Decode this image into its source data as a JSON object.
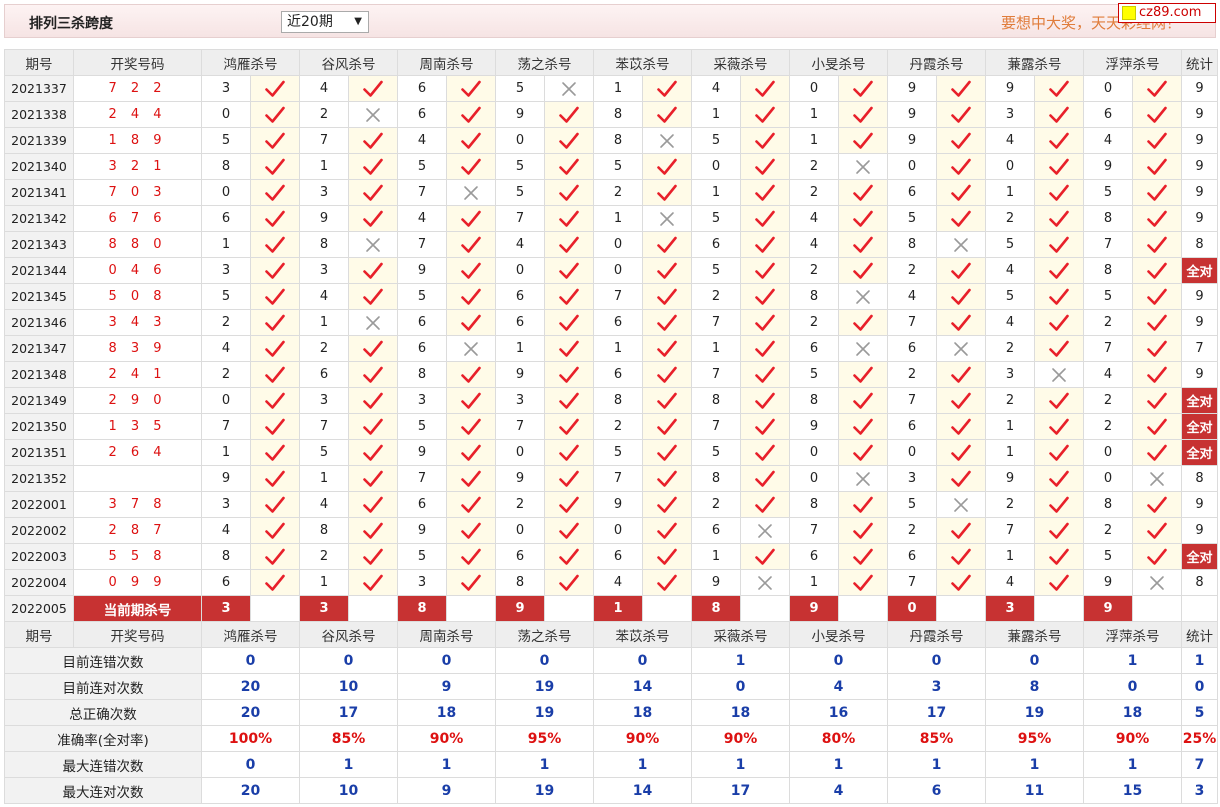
{
  "header": {
    "title": "排列三杀跨度",
    "period_select": "近20期",
    "slogan": "要想中大奖，天天彩经网！",
    "site_badge": "cz89.com"
  },
  "columns": {
    "period": "期号",
    "winning": "开奖号码",
    "experts": [
      "鸿雁杀号",
      "谷风杀号",
      "周南杀号",
      "荡之杀号",
      "苯苡杀号",
      "采薇杀号",
      "小旻杀号",
      "丹霞杀号",
      "蒹露杀号",
      "浮萍杀号"
    ],
    "stat": "统计"
  },
  "rows": [
    {
      "period": "2021337",
      "win": "7 2 2",
      "cells": [
        [
          3,
          1
        ],
        [
          4,
          1
        ],
        [
          6,
          1
        ],
        [
          5,
          0
        ],
        [
          1,
          1
        ],
        [
          4,
          1
        ],
        [
          0,
          1
        ],
        [
          9,
          1
        ],
        [
          9,
          1
        ],
        [
          0,
          1
        ]
      ],
      "stat": "9"
    },
    {
      "period": "2021338",
      "win": "2 4 4",
      "cells": [
        [
          0,
          1
        ],
        [
          2,
          0
        ],
        [
          6,
          1
        ],
        [
          9,
          1
        ],
        [
          8,
          1
        ],
        [
          1,
          1
        ],
        [
          1,
          1
        ],
        [
          9,
          1
        ],
        [
          3,
          1
        ],
        [
          6,
          1
        ]
      ],
      "stat": "9"
    },
    {
      "period": "2021339",
      "win": "1 8 9",
      "cells": [
        [
          5,
          1
        ],
        [
          7,
          1
        ],
        [
          4,
          1
        ],
        [
          0,
          1
        ],
        [
          8,
          0
        ],
        [
          5,
          1
        ],
        [
          1,
          1
        ],
        [
          9,
          1
        ],
        [
          4,
          1
        ],
        [
          4,
          1
        ]
      ],
      "stat": "9"
    },
    {
      "period": "2021340",
      "win": "3 2 1",
      "cells": [
        [
          8,
          1
        ],
        [
          1,
          1
        ],
        [
          5,
          1
        ],
        [
          5,
          1
        ],
        [
          5,
          1
        ],
        [
          0,
          1
        ],
        [
          2,
          0
        ],
        [
          0,
          1
        ],
        [
          0,
          1
        ],
        [
          9,
          1
        ]
      ],
      "stat": "9"
    },
    {
      "period": "2021341",
      "win": "7 0 3",
      "cells": [
        [
          0,
          1
        ],
        [
          3,
          1
        ],
        [
          7,
          0
        ],
        [
          5,
          1
        ],
        [
          2,
          1
        ],
        [
          1,
          1
        ],
        [
          2,
          1
        ],
        [
          6,
          1
        ],
        [
          1,
          1
        ],
        [
          5,
          1
        ]
      ],
      "stat": "9"
    },
    {
      "period": "2021342",
      "win": "6 7 6",
      "cells": [
        [
          6,
          1
        ],
        [
          9,
          1
        ],
        [
          4,
          1
        ],
        [
          7,
          1
        ],
        [
          1,
          0
        ],
        [
          5,
          1
        ],
        [
          4,
          1
        ],
        [
          5,
          1
        ],
        [
          2,
          1
        ],
        [
          8,
          1
        ]
      ],
      "stat": "9"
    },
    {
      "period": "2021343",
      "win": "8 8 0",
      "cells": [
        [
          1,
          1
        ],
        [
          8,
          0
        ],
        [
          7,
          1
        ],
        [
          4,
          1
        ],
        [
          0,
          1
        ],
        [
          6,
          1
        ],
        [
          4,
          1
        ],
        [
          8,
          0
        ],
        [
          5,
          1
        ],
        [
          7,
          1
        ]
      ],
      "stat": "8"
    },
    {
      "period": "2021344",
      "win": "0 4 6",
      "cells": [
        [
          3,
          1
        ],
        [
          3,
          1
        ],
        [
          9,
          1
        ],
        [
          0,
          1
        ],
        [
          0,
          1
        ],
        [
          5,
          1
        ],
        [
          2,
          1
        ],
        [
          2,
          1
        ],
        [
          4,
          1
        ],
        [
          8,
          1
        ]
      ],
      "stat": "全对"
    },
    {
      "period": "2021345",
      "win": "5 0 8",
      "cells": [
        [
          5,
          1
        ],
        [
          4,
          1
        ],
        [
          5,
          1
        ],
        [
          6,
          1
        ],
        [
          7,
          1
        ],
        [
          2,
          1
        ],
        [
          8,
          0
        ],
        [
          4,
          1
        ],
        [
          5,
          1
        ],
        [
          5,
          1
        ]
      ],
      "stat": "9"
    },
    {
      "period": "2021346",
      "win": "3 4 3",
      "cells": [
        [
          2,
          1
        ],
        [
          1,
          0
        ],
        [
          6,
          1
        ],
        [
          6,
          1
        ],
        [
          6,
          1
        ],
        [
          7,
          1
        ],
        [
          2,
          1
        ],
        [
          7,
          1
        ],
        [
          4,
          1
        ],
        [
          2,
          1
        ]
      ],
      "stat": "9"
    },
    {
      "period": "2021347",
      "win": "8 3 9",
      "cells": [
        [
          4,
          1
        ],
        [
          2,
          1
        ],
        [
          6,
          0
        ],
        [
          1,
          1
        ],
        [
          1,
          1
        ],
        [
          1,
          1
        ],
        [
          6,
          0
        ],
        [
          6,
          0
        ],
        [
          2,
          1
        ],
        [
          7,
          1
        ]
      ],
      "stat": "7"
    },
    {
      "period": "2021348",
      "win": "2 4 1",
      "cells": [
        [
          2,
          1
        ],
        [
          6,
          1
        ],
        [
          8,
          1
        ],
        [
          9,
          1
        ],
        [
          6,
          1
        ],
        [
          7,
          1
        ],
        [
          5,
          1
        ],
        [
          2,
          1
        ],
        [
          3,
          0
        ],
        [
          4,
          1
        ]
      ],
      "stat": "9"
    },
    {
      "period": "2021349",
      "win": "2 9 0",
      "cells": [
        [
          0,
          1
        ],
        [
          3,
          1
        ],
        [
          3,
          1
        ],
        [
          3,
          1
        ],
        [
          8,
          1
        ],
        [
          8,
          1
        ],
        [
          8,
          1
        ],
        [
          7,
          1
        ],
        [
          2,
          1
        ],
        [
          2,
          1
        ]
      ],
      "stat": "全对"
    },
    {
      "period": "2021350",
      "win": "1 3 5",
      "cells": [
        [
          7,
          1
        ],
        [
          7,
          1
        ],
        [
          5,
          1
        ],
        [
          7,
          1
        ],
        [
          2,
          1
        ],
        [
          7,
          1
        ],
        [
          9,
          1
        ],
        [
          6,
          1
        ],
        [
          1,
          1
        ],
        [
          2,
          1
        ]
      ],
      "stat": "全对"
    },
    {
      "period": "2021351",
      "win": "2 6 4",
      "cells": [
        [
          1,
          1
        ],
        [
          5,
          1
        ],
        [
          9,
          1
        ],
        [
          0,
          1
        ],
        [
          5,
          1
        ],
        [
          5,
          1
        ],
        [
          0,
          1
        ],
        [
          0,
          1
        ],
        [
          1,
          1
        ],
        [
          0,
          1
        ]
      ],
      "stat": "全对"
    },
    {
      "period": "2021352",
      "win": "",
      "cells": [
        [
          9,
          1
        ],
        [
          1,
          1
        ],
        [
          7,
          1
        ],
        [
          9,
          1
        ],
        [
          7,
          1
        ],
        [
          8,
          1
        ],
        [
          0,
          0
        ],
        [
          3,
          1
        ],
        [
          9,
          1
        ],
        [
          0,
          0
        ]
      ],
      "stat": "8"
    },
    {
      "period": "2022001",
      "win": "3 7 8",
      "cells": [
        [
          3,
          1
        ],
        [
          4,
          1
        ],
        [
          6,
          1
        ],
        [
          2,
          1
        ],
        [
          9,
          1
        ],
        [
          2,
          1
        ],
        [
          8,
          1
        ],
        [
          5,
          0
        ],
        [
          2,
          1
        ],
        [
          8,
          1
        ]
      ],
      "stat": "9"
    },
    {
      "period": "2022002",
      "win": "2 8 7",
      "cells": [
        [
          4,
          1
        ],
        [
          8,
          1
        ],
        [
          9,
          1
        ],
        [
          0,
          1
        ],
        [
          0,
          1
        ],
        [
          6,
          0
        ],
        [
          7,
          1
        ],
        [
          2,
          1
        ],
        [
          7,
          1
        ],
        [
          2,
          1
        ]
      ],
      "stat": "9"
    },
    {
      "period": "2022003",
      "win": "5 5 8",
      "cells": [
        [
          8,
          1
        ],
        [
          2,
          1
        ],
        [
          5,
          1
        ],
        [
          6,
          1
        ],
        [
          6,
          1
        ],
        [
          1,
          1
        ],
        [
          6,
          1
        ],
        [
          6,
          1
        ],
        [
          1,
          1
        ],
        [
          5,
          1
        ]
      ],
      "stat": "全对"
    },
    {
      "period": "2022004",
      "win": "0 9 9",
      "cells": [
        [
          6,
          1
        ],
        [
          1,
          1
        ],
        [
          3,
          1
        ],
        [
          8,
          1
        ],
        [
          4,
          1
        ],
        [
          9,
          0
        ],
        [
          1,
          1
        ],
        [
          7,
          1
        ],
        [
          4,
          1
        ],
        [
          9,
          0
        ]
      ],
      "stat": "8"
    }
  ],
  "current": {
    "period": "2022005",
    "label": "当前期杀号",
    "values": [
      "3",
      "3",
      "8",
      "9",
      "1",
      "8",
      "9",
      "0",
      "3",
      "9"
    ]
  },
  "summary": [
    {
      "label": "目前连错次数",
      "values": [
        "0",
        "0",
        "0",
        "0",
        "0",
        "1",
        "0",
        "0",
        "0",
        "1"
      ],
      "stat": "1"
    },
    {
      "label": "目前连对次数",
      "values": [
        "20",
        "10",
        "9",
        "19",
        "14",
        "0",
        "4",
        "3",
        "8",
        "0"
      ],
      "stat": "0"
    },
    {
      "label": "总正确次数",
      "values": [
        "20",
        "17",
        "18",
        "19",
        "18",
        "18",
        "16",
        "17",
        "19",
        "18"
      ],
      "stat": "5"
    },
    {
      "label": "准确率(全对率)",
      "values": [
        "100%",
        "85%",
        "90%",
        "95%",
        "90%",
        "90%",
        "80%",
        "85%",
        "95%",
        "90%"
      ],
      "stat": "25%",
      "rate": true
    },
    {
      "label": "最大连错次数",
      "values": [
        "0",
        "1",
        "1",
        "1",
        "1",
        "1",
        "1",
        "1",
        "1",
        "1"
      ],
      "stat": "7"
    },
    {
      "label": "最大连对次数",
      "values": [
        "20",
        "10",
        "9",
        "19",
        "14",
        "17",
        "4",
        "6",
        "11",
        "15"
      ],
      "stat": "3"
    }
  ],
  "icons": {
    "correct": "check-icon",
    "wrong": "cross-icon"
  },
  "colors": {
    "check": "#e8202a",
    "cross": "#9a9a9a",
    "highlight": "#c73232",
    "summary_value": "#1a3ea8",
    "rate": "#d11111"
  }
}
